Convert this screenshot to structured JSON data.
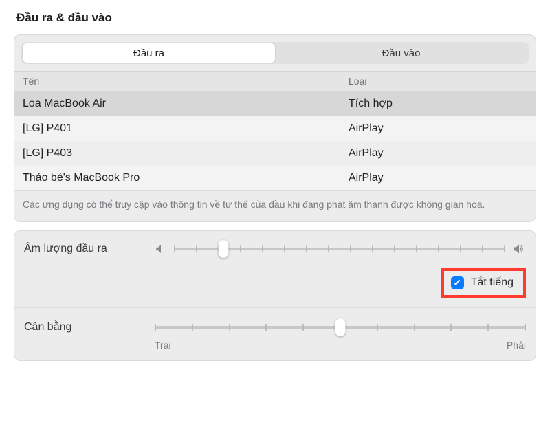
{
  "title": "Đầu ra & đầu vào",
  "tabs": {
    "output_label": "Đầu ra",
    "input_label": "Đầu vào",
    "active": "output"
  },
  "table": {
    "columns": {
      "name": "Tên",
      "type": "Loại"
    },
    "rows": [
      {
        "name": "Loa MacBook Air",
        "type": "Tích hợp",
        "selected": true
      },
      {
        "name": "[LG] P401",
        "type": "AirPlay",
        "selected": false
      },
      {
        "name": "[LG] P403",
        "type": "AirPlay",
        "selected": false
      },
      {
        "name": "Thảo bé's MacBook Pro",
        "type": "AirPlay",
        "selected": false
      }
    ]
  },
  "note": "Các ứng dụng có thể truy cập vào thông tin về tư thế của đầu khi đang phát âm thanh được không gian hóa.",
  "output_volume": {
    "label": "Âm lượng đầu ra",
    "value_percent": 15,
    "mute_label": "Tắt tiếng",
    "mute_checked": true
  },
  "balance": {
    "label": "Cân bằng",
    "value_percent": 50,
    "left_label": "Trái",
    "right_label": "Phải"
  }
}
